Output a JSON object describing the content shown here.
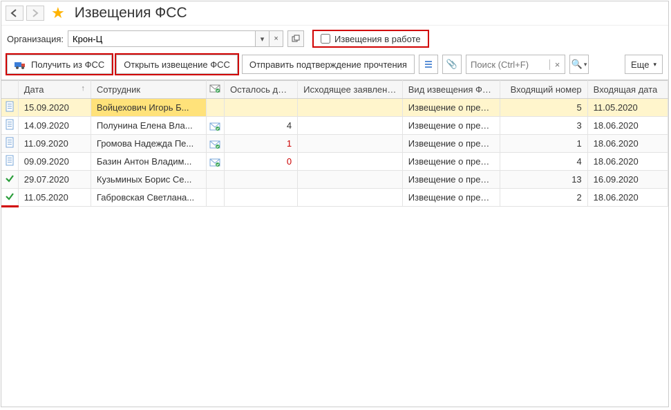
{
  "header": {
    "title": "Извещения ФСС"
  },
  "filter": {
    "org_label": "Организация:",
    "org_value": "Крон-Ц",
    "checkbox_label": "Извещения в работе"
  },
  "toolbar": {
    "get_from_fss": "Получить из ФСС",
    "open_notice": "Открыть извещение ФСС",
    "send_confirm": "Отправить подтверждение прочтения",
    "search_placeholder": "Поиск (Ctrl+F)",
    "more": "Еще"
  },
  "table": {
    "headers": {
      "date": "Дата",
      "employee": "Сотрудник",
      "days_left": "Осталось дней",
      "outgoing": "Исходящее заявление",
      "type": "Вид извещения ФСС",
      "in_num": "Входящий номер",
      "in_date": "Входящая дата"
    },
    "rows": [
      {
        "icon": "doc",
        "date": "15.09.2020",
        "employee": "Войцехович Игорь Б...",
        "env": false,
        "days": "",
        "days_red": false,
        "outgoing": "",
        "type": "Извещение о предст...",
        "in_num": "5",
        "in_date": "11.05.2020",
        "selected": true,
        "underline": false
      },
      {
        "icon": "doc",
        "date": "14.09.2020",
        "employee": "Полунина Елена Вла...",
        "env": true,
        "days": "4",
        "days_red": false,
        "outgoing": "",
        "type": "Извещение о предст...",
        "in_num": "3",
        "in_date": "18.06.2020",
        "selected": false,
        "underline": false
      },
      {
        "icon": "doc",
        "date": "11.09.2020",
        "employee": "Громова Надежда Пе...",
        "env": true,
        "days": "1",
        "days_red": true,
        "outgoing": "",
        "type": "Извещение о предст...",
        "in_num": "1",
        "in_date": "18.06.2020",
        "selected": false,
        "underline": false
      },
      {
        "icon": "doc",
        "date": "09.09.2020",
        "employee": "Базин Антон Владим...",
        "env": true,
        "days": "0",
        "days_red": true,
        "outgoing": "",
        "type": "Извещение о предст...",
        "in_num": "4",
        "in_date": "18.06.2020",
        "selected": false,
        "underline": false
      },
      {
        "icon": "check",
        "date": "29.07.2020",
        "employee": "Кузьминых Борис Се...",
        "env": false,
        "days": "",
        "days_red": false,
        "outgoing": "",
        "type": "Извещение о предст...",
        "in_num": "13",
        "in_date": "16.09.2020",
        "selected": false,
        "underline": false
      },
      {
        "icon": "check",
        "date": "11.05.2020",
        "employee": "Габровская Светлана...",
        "env": false,
        "days": "",
        "days_red": false,
        "outgoing": "",
        "type": "Извещение о предст...",
        "in_num": "2",
        "in_date": "18.06.2020",
        "selected": false,
        "underline": true
      }
    ]
  }
}
